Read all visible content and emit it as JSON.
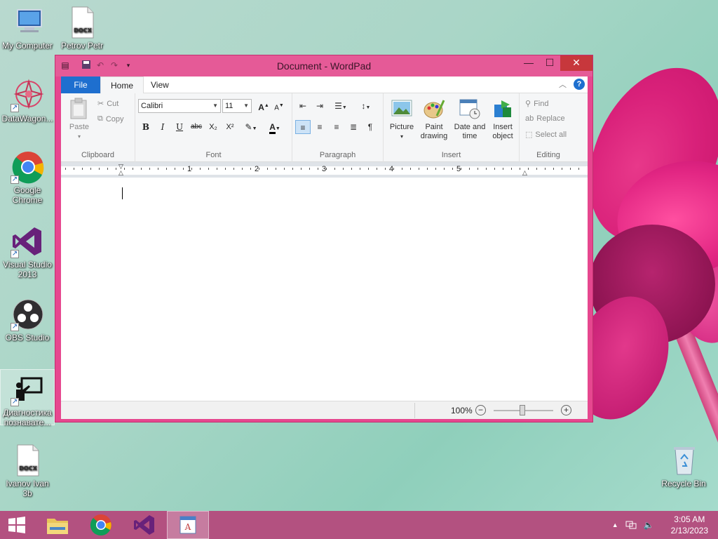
{
  "desktop": {
    "icons": [
      {
        "label": "My Computer"
      },
      {
        "label": "Petrov Petr",
        "badge": "DOCX"
      },
      {
        "label": "DataWagon..."
      },
      {
        "label": "Google Chrome"
      },
      {
        "label": "Visual Studio 2013"
      },
      {
        "label": "OBS Studio"
      },
      {
        "label": "Диагностика познавате..."
      },
      {
        "label": "Ivanov Ivan 3b",
        "badge": "DOCX"
      },
      {
        "label": "Recycle Bin"
      }
    ]
  },
  "window": {
    "title": "Document - WordPad",
    "controls": {
      "minimize": "—",
      "maximize": "☐",
      "close": "✕"
    }
  },
  "ribbon": {
    "tabs": {
      "file": "File",
      "home": "Home",
      "view": "View"
    },
    "clipboard": {
      "label": "Clipboard",
      "paste": "Paste",
      "cut": "Cut",
      "copy": "Copy"
    },
    "font": {
      "label": "Font",
      "family": "Calibri",
      "size": "11",
      "bold": "B",
      "italic": "I",
      "underline": "U",
      "strike": "abc",
      "subscript": "X₂",
      "superscript": "X²"
    },
    "paragraph": {
      "label": "Paragraph"
    },
    "insert": {
      "label": "Insert",
      "picture": "Picture",
      "paint_line1": "Paint",
      "paint_line2": "drawing",
      "datetime_line1": "Date and",
      "datetime_line2": "time",
      "object_line1": "Insert",
      "object_line2": "object"
    },
    "editing": {
      "label": "Editing",
      "find": "Find",
      "replace": "Replace",
      "select_all": "Select all"
    }
  },
  "ruler": {
    "numbers": [
      "1",
      "2",
      "3",
      "4",
      "5"
    ]
  },
  "statusbar": {
    "zoom": "100%",
    "zoom_out": "−",
    "zoom_in": "+"
  },
  "taskbar": {
    "time": "3:05 AM",
    "date": "2/13/2023"
  }
}
